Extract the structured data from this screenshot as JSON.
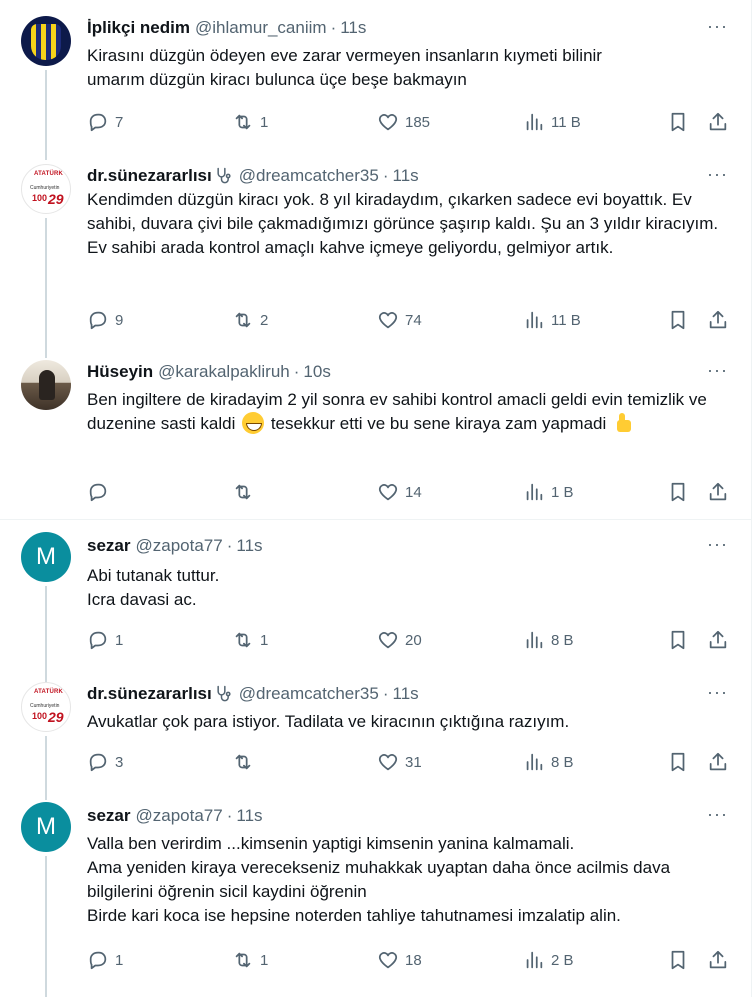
{
  "tweets": [
    {
      "name": "İplikçi nedim",
      "handle": "@ihlamur_caniim",
      "dot": "·",
      "time": "11s",
      "text": "Kirasını düzgün ödeyen eve zarar vermeyen insanların kıymeti bilinir\numarım düzgün kiracı bulunca üçe beşe bakmayın",
      "replies": "7",
      "retweets": "1",
      "likes": "185",
      "views": "11 B",
      "avatar": "football-fan-avatar"
    },
    {
      "name": "dr.sünezararlısı",
      "handle": "@dreamcatcher35",
      "dot": "·",
      "time": "11s",
      "text": "Kendimden düzgün kiracı yok. 8 yıl kiradaydım, çıkarken sadece evi boyattık. Ev sahibi, duvara çivi bile çakmadığımızı görünce şaşırıp kaldı. Şu an 3 yıldır kiracıyım. Ev sahibi arada kontrol amaçlı kahve içmeye geliyordu, gelmiyor artık.",
      "replies": "9",
      "retweets": "2",
      "likes": "74",
      "views": "11 B",
      "avatar": "ataturk-poster-avatar",
      "avatar_text": [
        "ATATÜRK",
        "Cumhuriyetin",
        "100",
        "29"
      ]
    },
    {
      "name": "Hüseyin",
      "handle": "@karakalpakliruh",
      "dot": "·",
      "time": "10s",
      "text_a": "Ben ingiltere de kiradayim 2 yil sonra ev sahibi kontrol amacli geldi evin temizlik ve duzenine sasti kaldi",
      "text_b": " tesekkur etti ve bu sene kiraya zam yapmadi",
      "replies": "",
      "retweets": "",
      "likes": "14",
      "views": "1 B",
      "avatar": "photo-avatar"
    },
    {
      "name": "sezar",
      "handle": "@zapota77",
      "dot": "·",
      "time": "11s",
      "text": "Abi tutanak tuttur.\nIcra davasi ac.",
      "replies": "1",
      "retweets": "1",
      "likes": "20",
      "views": "8 B",
      "avatar_letter": "M"
    },
    {
      "name": "dr.sünezararlısı",
      "handle": "@dreamcatcher35",
      "dot": "·",
      "time": "11s",
      "text": "Avukatlar çok para istiyor. Tadilata ve kiracının çıktığına razıyım.",
      "replies": "3",
      "retweets": "",
      "likes": "31",
      "views": "8 B",
      "avatar": "ataturk-poster-avatar",
      "avatar_text": [
        "ATATÜRK",
        "Cumhuriyetin",
        "100",
        "29"
      ]
    },
    {
      "name": "sezar",
      "handle": "@zapota77",
      "dot": "·",
      "time": "11s",
      "text": "Valla ben verirdim ...kimsenin yaptigi kimsenin yanina kalmamali.\nAma yeniden kiraya verecekseniz muhakkak uyaptan daha önce acilmis dava bilgilerini öğrenin sicil kaydini öğrenin\nBirde kari koca ise hepsine noterden tahliye tahutnamesi imzalatip alin.",
      "replies": "1",
      "retweets": "1",
      "likes": "18",
      "views": "2 B",
      "avatar_letter": "M"
    }
  ],
  "more_glyph": "···",
  "colors": {
    "text": "#0f1419",
    "muted": "#536471",
    "line": "#cfd9de",
    "avatar_m": "#0a8e9e"
  }
}
